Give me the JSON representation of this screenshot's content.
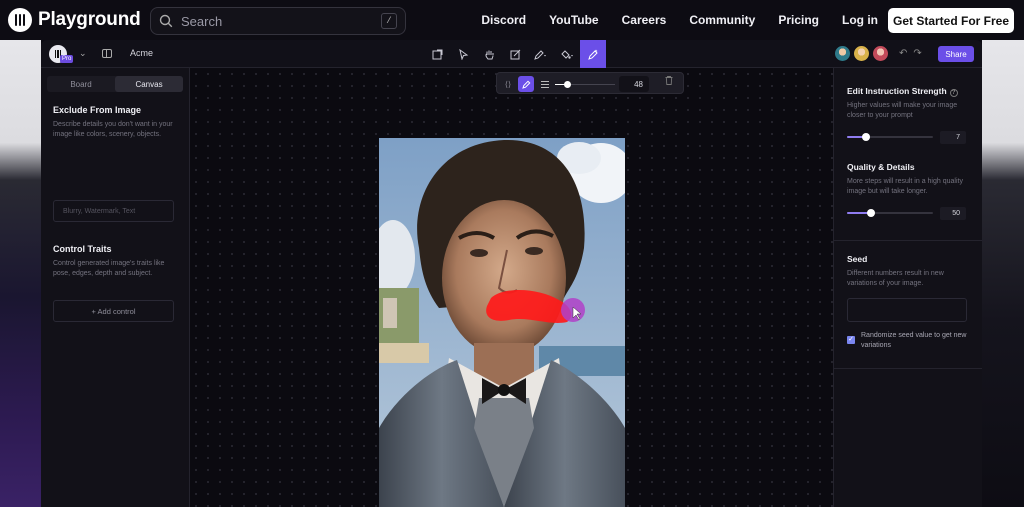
{
  "site_nav": {
    "brand": "Playground",
    "search_placeholder": "Search",
    "search_shortcut": "/",
    "links": [
      "Discord",
      "YouTube",
      "Careers",
      "Community",
      "Pricing",
      "Log in"
    ],
    "cta": "Get Started For Free"
  },
  "app_bar": {
    "plan_badge": "Pro",
    "workspace": "Acme",
    "tools": [
      "import-icon",
      "select-icon",
      "hand-icon",
      "edit-icon",
      "pen-icon",
      "fill-icon",
      "brush-edit-icon"
    ],
    "active_tool": "brush-edit-icon",
    "share_label": "Share",
    "accent": "#6b4fe8"
  },
  "left_panel": {
    "tabs": [
      "Board",
      "Canvas"
    ],
    "active_tab": "Canvas",
    "exclude": {
      "title": "Exclude From Image",
      "description": "Describe details you don't want in your image like colors, scenery, objects.",
      "placeholder": "Blurry, Watermark, Text"
    },
    "control": {
      "title": "Control Traits",
      "description": "Control generated image's traits like pose, edges, depth and subject.",
      "add_label": "+ Add control"
    }
  },
  "brush_bar": {
    "size": "48",
    "size_fraction": 0.2
  },
  "right_panel": {
    "instruction": {
      "title": "Edit Instruction Strength",
      "description": "Higher values will make your image closer to your prompt",
      "value": "7",
      "fraction": 0.22
    },
    "quality": {
      "title": "Quality & Details",
      "description": "More steps will result in a high quality image but will take longer.",
      "value": "50",
      "fraction": 0.28
    },
    "seed": {
      "title": "Seed",
      "description": "Different numbers result in new variations of your image.",
      "randomize_label": "Randomize seed value to get new variations",
      "randomize_checked": true
    }
  }
}
